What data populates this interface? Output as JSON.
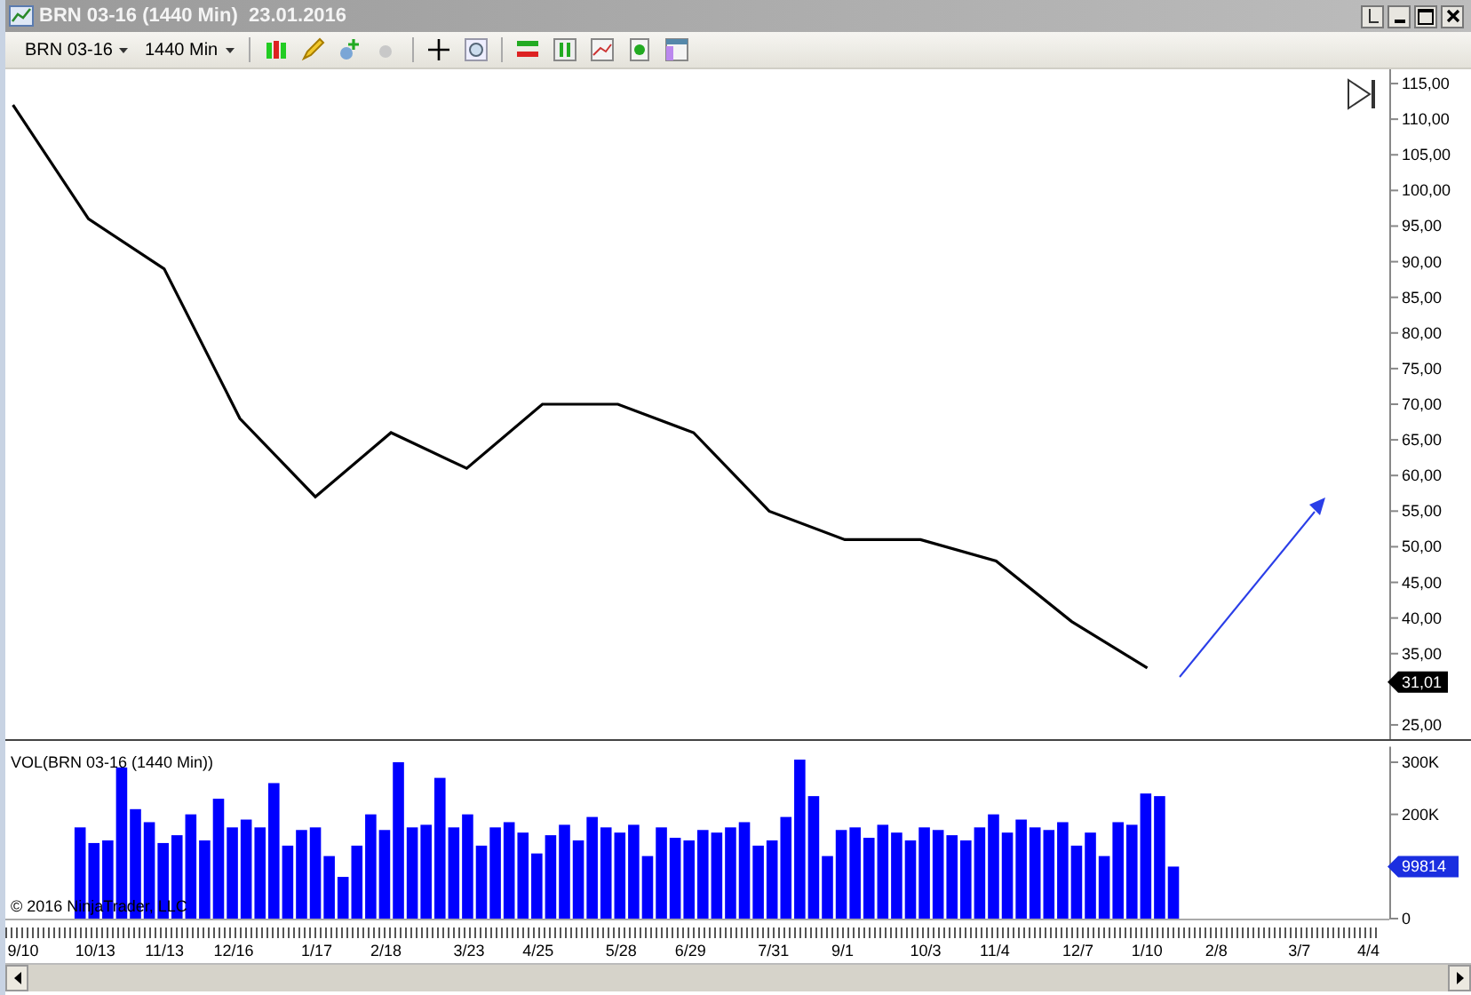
{
  "window": {
    "title": "BRN 03-16 (1440 Min)  23.01.2016"
  },
  "toolbar": {
    "instrument": "BRN 03-16",
    "interval": "1440 Min"
  },
  "price_panel": {
    "last_price": "31,01",
    "chart_data": {
      "type": "line",
      "series": [
        {
          "color": "#000000",
          "values": [
            112,
            96,
            89,
            68,
            57,
            66,
            61,
            70,
            70,
            66,
            55,
            51,
            51,
            48,
            39.5,
            33,
            null,
            null,
            null
          ]
        }
      ],
      "ylim": [
        23,
        117
      ],
      "yticks": [
        {
          "value": 115,
          "label": "115,00"
        },
        {
          "value": 110,
          "label": "110,00"
        },
        {
          "value": 105,
          "label": "105,00"
        },
        {
          "value": 100,
          "label": "100,00"
        },
        {
          "value": 95,
          "label": "95,00"
        },
        {
          "value": 90,
          "label": "90,00"
        },
        {
          "value": 85,
          "label": "85,00"
        },
        {
          "value": 80,
          "label": "80,00"
        },
        {
          "value": 75,
          "label": "75,00"
        },
        {
          "value": 70,
          "label": "70,00"
        },
        {
          "value": 65,
          "label": "65,00"
        },
        {
          "value": 60,
          "label": "60,00"
        },
        {
          "value": 55,
          "label": "55,00"
        },
        {
          "value": 50,
          "label": "50,00"
        },
        {
          "value": 45,
          "label": "45,00"
        },
        {
          "value": 40,
          "label": "40,00"
        },
        {
          "value": 35,
          "label": "35,00"
        },
        {
          "value": 25,
          "label": "25,00"
        }
      ]
    }
  },
  "volume_panel": {
    "last_volume": "99814",
    "copyright": "© 2016 NinjaTrader, LLC",
    "chart_data": {
      "type": "bar",
      "title": "VOL(BRN 03-16 (1440 Min))",
      "categories": [
        "9/10",
        null,
        null,
        null,
        null,
        null,
        "10/13",
        null,
        null,
        null,
        null,
        "11/13",
        null,
        null,
        null,
        null,
        "12/16",
        null,
        null,
        null,
        null,
        null,
        "1/17",
        null,
        null,
        null,
        null,
        "2/18",
        null,
        null,
        null,
        null,
        null,
        "3/23",
        null,
        null,
        null,
        null,
        "4/25",
        null,
        null,
        null,
        null,
        null,
        "5/28",
        null,
        null,
        null,
        null,
        "6/29",
        null,
        null,
        null,
        null,
        null,
        "7/31",
        null,
        null,
        null,
        null,
        "9/1",
        null,
        null,
        null,
        null,
        null,
        "10/3",
        null,
        null,
        null,
        null,
        "11/4",
        null,
        null,
        null,
        null,
        null,
        "12/7",
        null,
        null,
        null,
        null,
        "1/10",
        null,
        null,
        null,
        null,
        "2/8",
        null,
        null,
        null,
        null,
        null,
        "3/7",
        null,
        null,
        null,
        null,
        "4/4",
        null
      ],
      "series": [
        {
          "color": "#0000ff",
          "values": [
            null,
            null,
            null,
            null,
            null,
            175000,
            145000,
            150000,
            290000,
            210000,
            185000,
            145000,
            160000,
            200000,
            150000,
            230000,
            175000,
            190000,
            175000,
            260000,
            140000,
            170000,
            175000,
            120000,
            80000,
            140000,
            200000,
            170000,
            300000,
            175000,
            180000,
            270000,
            175000,
            200000,
            140000,
            175000,
            185000,
            165000,
            125000,
            160000,
            180000,
            150000,
            195000,
            175000,
            165000,
            180000,
            120000,
            175000,
            155000,
            150000,
            170000,
            165000,
            175000,
            185000,
            140000,
            150000,
            195000,
            305000,
            235000,
            120000,
            170000,
            175000,
            155000,
            180000,
            165000,
            150000,
            175000,
            170000,
            160000,
            150000,
            175000,
            200000,
            165000,
            190000,
            175000,
            170000,
            185000,
            140000,
            165000,
            120000,
            185000,
            180000,
            240000,
            235000,
            99814,
            null,
            null,
            null,
            null,
            null,
            null,
            null,
            null,
            null,
            null,
            null,
            null,
            null,
            null,
            null
          ]
        }
      ],
      "ylim": [
        0,
        330000
      ],
      "yticks": [
        {
          "value": 300000,
          "label": "300K"
        },
        {
          "value": 200000,
          "label": "200K"
        },
        {
          "value": 0,
          "label": "0"
        }
      ]
    }
  }
}
